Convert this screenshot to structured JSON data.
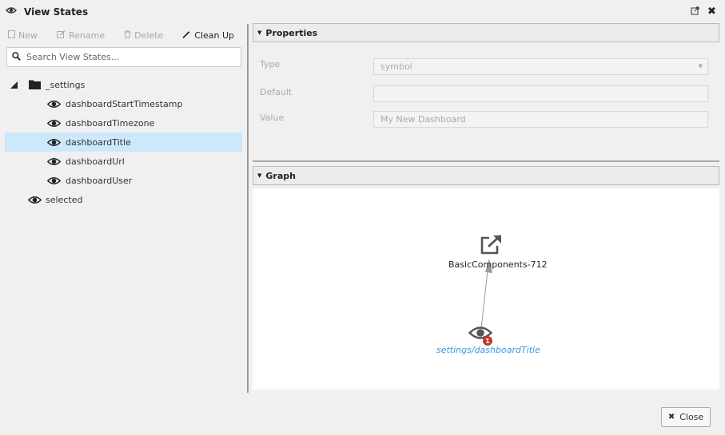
{
  "window": {
    "title": "View States"
  },
  "toolbar": {
    "new_label": "New",
    "rename_label": "Rename",
    "delete_label": "Delete",
    "cleanup_label": "Clean Up"
  },
  "search": {
    "placeholder": "Search View States..."
  },
  "tree": {
    "folder": {
      "label": "_settings",
      "expanded": true
    },
    "children": [
      {
        "label": "dashboardStartTimestamp"
      },
      {
        "label": "dashboardTimezone"
      },
      {
        "label": "dashboardTitle",
        "selected": true
      },
      {
        "label": "dashboardUrl"
      },
      {
        "label": "dashboardUser"
      }
    ],
    "root_items": [
      {
        "label": "selected"
      }
    ]
  },
  "properties": {
    "header": "Properties",
    "type_label": "Type",
    "type_value": "symbol",
    "default_label": "Default",
    "default_value": "",
    "value_label": "Value",
    "value_value": "My New Dashboard"
  },
  "graph": {
    "header": "Graph",
    "target_node": {
      "label": "BasicComponents-712",
      "icon": "external-link-icon"
    },
    "source_node": {
      "label": "settings/dashboardTitle",
      "icon": "eye-icon",
      "badge": "1"
    }
  },
  "footer": {
    "close_label": "Close"
  },
  "colors": {
    "selection": "#cce8fb",
    "link": "#3a9ae0",
    "badge": "#c0392b"
  }
}
